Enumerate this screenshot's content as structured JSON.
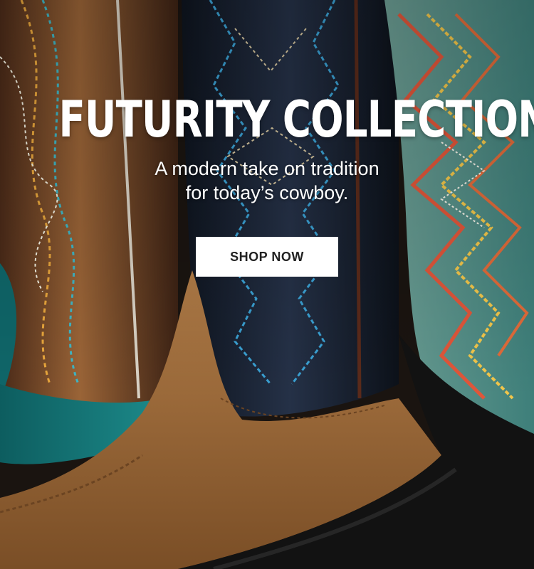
{
  "hero": {
    "headline": "FUTURITY COLLECTION",
    "subhead_line1": "A modern take on tradition",
    "subhead_line2": "for today’s cowboy.",
    "cta_label": "SHOP NOW"
  },
  "colors": {
    "headline_text": "#ffffff",
    "cta_background": "#ffffff",
    "cta_text": "#222222",
    "brown_leather": "#7a4a2a",
    "navy_leather": "#1c2431",
    "tan_suede": "#a8733f",
    "turquoise": "#1f8a8a",
    "black_suede": "#111111"
  }
}
